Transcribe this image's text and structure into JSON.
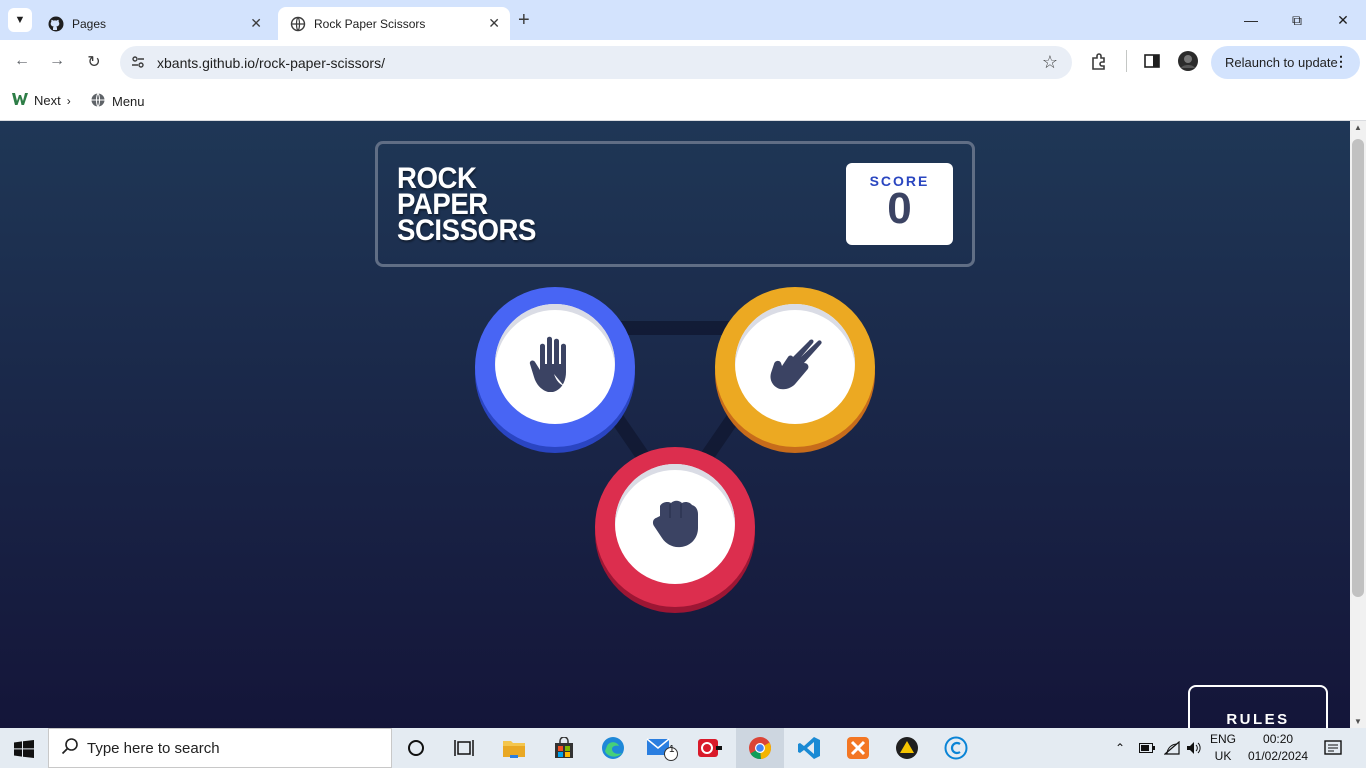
{
  "browser": {
    "tabs": [
      {
        "title": "Pages",
        "favicon": "github-icon"
      },
      {
        "title": "Rock Paper Scissors",
        "favicon": "globe-icon",
        "active": true
      }
    ],
    "url": "xbants.github.io/rock-paper-scissors/",
    "relaunch_label": "Relaunch to update",
    "bookmarks": [
      {
        "label": "Next",
        "icon": "w-logo-icon"
      },
      {
        "label": "Menu",
        "icon": "globe-icon"
      }
    ]
  },
  "game": {
    "title_lines": [
      "ROCK",
      "PAPER",
      "SCISSORS"
    ],
    "score_label": "SCORE",
    "score_value": "0",
    "choices": [
      {
        "name": "paper",
        "color": "#4865f4"
      },
      {
        "name": "scissors",
        "color": "#eca922"
      },
      {
        "name": "rock",
        "color": "#dc2e4e"
      }
    ],
    "rules_label": "RULES"
  },
  "taskbar": {
    "search_placeholder": "Type here to search",
    "mail_badge": "1",
    "lang_top": "ENG",
    "lang_bottom": "UK",
    "time": "00:20",
    "date": "01/02/2024"
  }
}
